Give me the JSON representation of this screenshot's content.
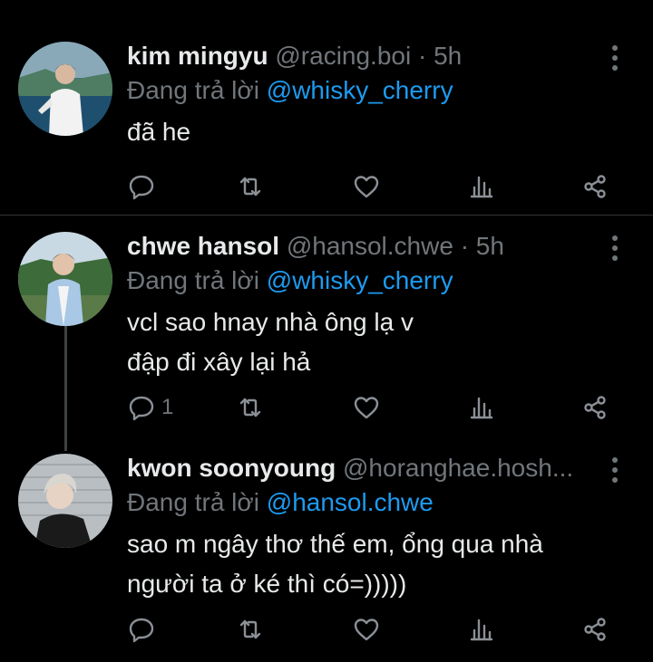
{
  "tweets": [
    {
      "name": "kim mingyu",
      "handle": "@racing.boi",
      "dot": "·",
      "time": "5h",
      "reply_prefix": "Đang trả lời",
      "reply_to": "@whisky_cherry",
      "text": "đã he",
      "reply_count": ""
    },
    {
      "name": "chwe hansol",
      "handle": "@hansol.chwe",
      "dot": "·",
      "time": "5h",
      "reply_prefix": "Đang trả lời",
      "reply_to": "@whisky_cherry",
      "text": "vcl sao hnay nhà ông lạ v\nđập đi xây lại hả",
      "reply_count": "1"
    },
    {
      "name": "kwon soonyoung",
      "handle": "@horanghae.hosh...",
      "dot": "",
      "time": "",
      "reply_prefix": "Đang trả lời",
      "reply_to": "@hansol.chwe",
      "text": "sao m ngây thơ thế em, ổng qua nhà\nngười ta ở ké thì có=)))))",
      "reply_count": ""
    }
  ],
  "icons": [
    "reply-icon",
    "retweet-icon",
    "like-icon",
    "views-icon",
    "share-icon",
    "more-icon"
  ],
  "colors": {
    "background": "#000000",
    "text": "#e7e9ea",
    "muted": "#71767b",
    "link": "#1d9bf0",
    "divider": "#2f3336"
  }
}
